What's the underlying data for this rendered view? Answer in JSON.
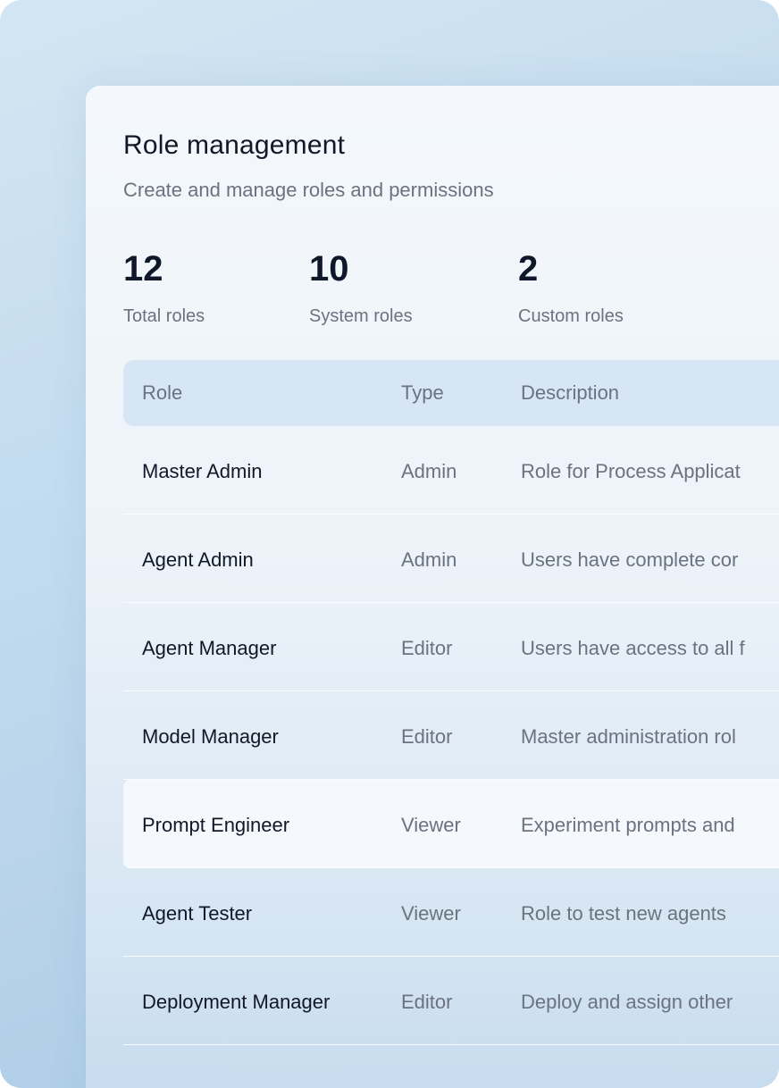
{
  "header": {
    "title": "Role management",
    "subtitle": "Create and manage roles and permissions"
  },
  "stats": [
    {
      "value": "12",
      "label": "Total roles"
    },
    {
      "value": "10",
      "label": "System roles"
    },
    {
      "value": "2",
      "label": "Custom roles"
    }
  ],
  "table": {
    "columns": [
      "Role",
      "Type",
      "Description"
    ],
    "rows": [
      {
        "role": "Master Admin",
        "type": "Admin",
        "description": "Role for Process Applicat"
      },
      {
        "role": "Agent Admin",
        "type": "Admin",
        "description": "Users have complete cor"
      },
      {
        "role": "Agent Manager",
        "type": "Editor",
        "description": "Users have access to all f"
      },
      {
        "role": "Model Manager",
        "type": "Editor",
        "description": "Master administration rol"
      },
      {
        "role": "Prompt Engineer",
        "type": "Viewer",
        "description": "Experiment prompts and"
      },
      {
        "role": "Agent Tester",
        "type": "Viewer",
        "description": "Role to test new agents"
      },
      {
        "role": "Deployment Manager",
        "type": "Editor",
        "description": "Deploy and assign other"
      }
    ]
  }
}
